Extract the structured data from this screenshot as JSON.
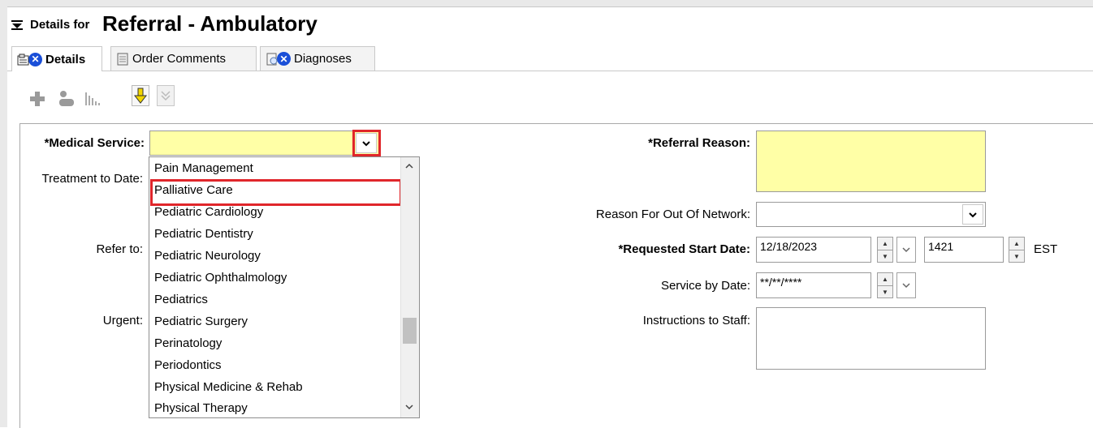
{
  "header": {
    "details_for": "Details for",
    "order_name": "Referral - Ambulatory"
  },
  "tabs": [
    {
      "label": "Details"
    },
    {
      "label": "Order Comments"
    },
    {
      "label": "Diagnoses"
    }
  ],
  "form": {
    "medical_service_label": "*Medical Service:",
    "medical_service_value": "",
    "treatment_to_date_label": "Treatment to Date:",
    "refer_to_label": "Refer to:",
    "urgent_label": "Urgent:",
    "referral_reason_label": "*Referral Reason:",
    "referral_reason_value": "",
    "out_of_network_label": "Reason For Out Of Network:",
    "out_of_network_value": "",
    "requested_start_label": "*Requested Start Date:",
    "requested_start_date": "12/18/2023",
    "requested_start_time": "1421",
    "timezone": "EST",
    "service_by_label": "Service by Date:",
    "service_by_value": "**/**/****",
    "instructions_label": "Instructions to Staff:",
    "instructions_value": ""
  },
  "dropdown": {
    "items": [
      "Pain Management",
      "Palliative Care",
      "Pediatric Cardiology",
      "Pediatric Dentistry",
      "Pediatric Neurology",
      "Pediatric Ophthalmology",
      "Pediatrics",
      "Pediatric Surgery",
      "Perinatology",
      "Periodontics",
      "Physical Medicine & Rehab",
      "Physical Therapy"
    ],
    "highlighted": "Palliative Care"
  },
  "colors": {
    "required_field": "#ffffa6",
    "highlight_box": "#e0262b",
    "tab_error_icon": "#1a4fd8"
  }
}
